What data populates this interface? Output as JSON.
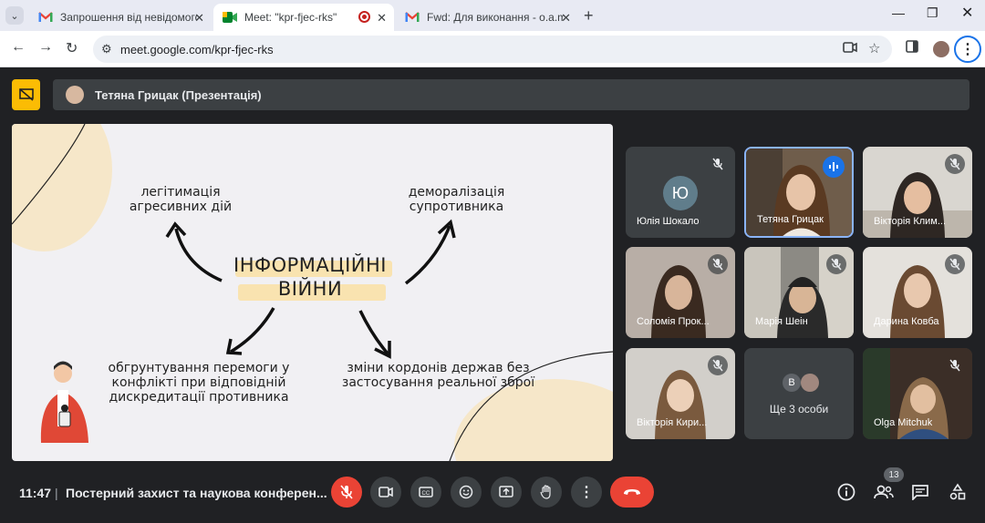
{
  "browser": {
    "tabs": [
      {
        "title": "Запрошення від невідомого в",
        "icon": "gmail-icon"
      },
      {
        "title": "Meet: \"kpr-fjec-rks\"",
        "icon": "meet-icon"
      },
      {
        "title": "Fwd: Для виконання - o.a.mitch",
        "icon": "gmail-icon"
      }
    ],
    "url": "meet.google.com/kpr-fjec-rks"
  },
  "presenter": {
    "name": "Тетяна Грицак (Презентація)"
  },
  "slide": {
    "title_line1": "ІНФОРМАЦІЙНІ",
    "title_line2": "ВІЙНИ",
    "top_left_line1": "легітимація",
    "top_left_line2": "агресивних дій",
    "top_right_line1": "деморалізація",
    "top_right_line2": "супротивника",
    "bottom_left_line1": "обгрунтування перемоги у",
    "bottom_left_line2": "конфлікті при відповідній",
    "bottom_left_line3": "дискредитації противника",
    "bottom_right_line1": "зміни кордонів держав без",
    "bottom_right_line2": "застосування реальної зброї"
  },
  "participants": [
    {
      "name": "Юлія Шокало",
      "initial": "Ю",
      "muted": true
    },
    {
      "name": "Тетяна Грицак",
      "speaking": true
    },
    {
      "name": "Вікторія Клим...",
      "muted": true
    },
    {
      "name": "Соломія Прок...",
      "muted": true
    },
    {
      "name": "Марія Шеін",
      "muted": true
    },
    {
      "name": "Дарина Ковба",
      "muted": true
    },
    {
      "name": "Вікторія Кири...",
      "muted": true
    },
    {
      "name": "Ще 3 особи",
      "initial": "В"
    },
    {
      "name": "Olga Mitchuk",
      "muted": true
    }
  ],
  "bottom_bar": {
    "time": "11:47",
    "separator": "|",
    "meeting_title": "Постерний захист та наукова конферен...",
    "participant_count": "13"
  },
  "colors": {
    "accent_yellow": "#fbbc04",
    "end_call_red": "#ea4335",
    "speaking_blue": "#1a73e8"
  }
}
